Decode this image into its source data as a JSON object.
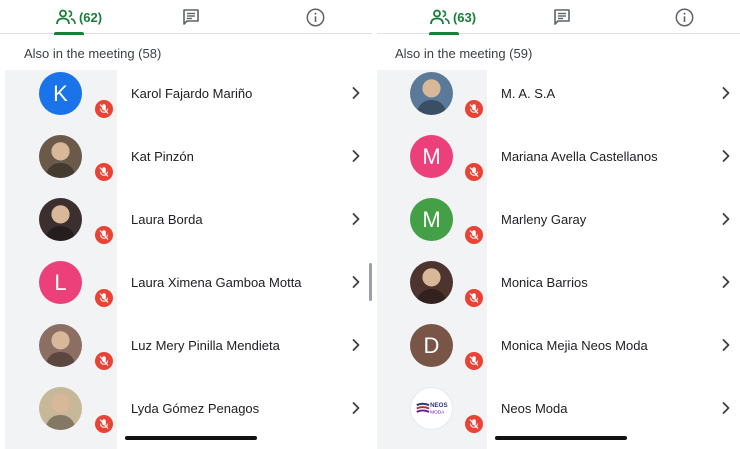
{
  "left_panel": {
    "participants_count": "(62)",
    "section_label": "Also in the meeting (58)",
    "people": [
      {
        "name": "Karol Fajardo Mariño",
        "avatar_letter": "K",
        "avatar_color": "#1a73e8",
        "avatar_kind": "letter"
      },
      {
        "name": "Kat Pinzón",
        "avatar_letter": "",
        "avatar_color": "#6b5a4a",
        "avatar_kind": "photo"
      },
      {
        "name": "Laura Borda",
        "avatar_letter": "",
        "avatar_color": "#3b2f2f",
        "avatar_kind": "photo"
      },
      {
        "name": "Laura Ximena Gamboa Motta",
        "avatar_letter": "L",
        "avatar_color": "#ec407a",
        "avatar_kind": "letter"
      },
      {
        "name": "Luz Mery Pinilla Mendieta",
        "avatar_letter": "",
        "avatar_color": "#8d6e63",
        "avatar_kind": "photo"
      },
      {
        "name": "Lyda Gómez Penagos",
        "avatar_letter": "",
        "avatar_color": "#c8b89a",
        "avatar_kind": "photo"
      }
    ]
  },
  "right_panel": {
    "participants_count": "(63)",
    "section_label": "Also in the meeting (59)",
    "people": [
      {
        "name": "M. A. S.A",
        "avatar_letter": "",
        "avatar_color": "#5b7a9a",
        "avatar_kind": "photo"
      },
      {
        "name": "Mariana Avella Castellanos",
        "avatar_letter": "M",
        "avatar_color": "#ec407a",
        "avatar_kind": "letter"
      },
      {
        "name": "Marleny Garay",
        "avatar_letter": "M",
        "avatar_color": "#43a047",
        "avatar_kind": "letter"
      },
      {
        "name": "Monica Barrios",
        "avatar_letter": "",
        "avatar_color": "#4e342e",
        "avatar_kind": "photo"
      },
      {
        "name": "Monica Mejia Neos Moda",
        "avatar_letter": "D",
        "avatar_color": "#795548",
        "avatar_kind": "letter"
      },
      {
        "name": "Neos Moda",
        "avatar_letter": "",
        "avatar_color": "#ffffff",
        "avatar_kind": "logo",
        "logo_text": "NEOS",
        "logo_subtext": "MODA"
      }
    ]
  },
  "icons": {
    "people_tab": "people-icon",
    "chat_tab": "chat-icon",
    "info_tab": "info-icon",
    "mute": "mic-off-icon",
    "row_action": "chevron-right-icon"
  },
  "colors": {
    "accent": "#188038",
    "mute_badge": "#ea4335",
    "gutter": "#f1f3f4"
  }
}
